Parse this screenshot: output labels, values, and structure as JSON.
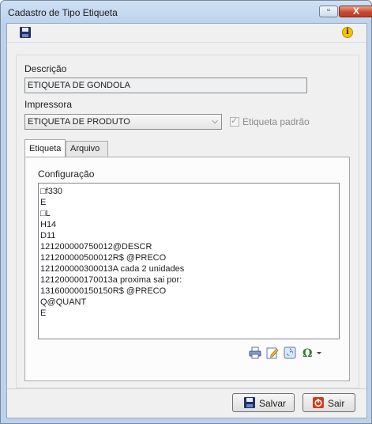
{
  "window": {
    "title": "Cadastro de Tipo Etiqueta",
    "min_symbol": "▫",
    "max_symbol": "◻",
    "close_symbol": "X"
  },
  "form": {
    "descricao_label": "Descrição",
    "descricao_value": "ETIQUETA DE GONDOLA",
    "impressora_label": "Impressora",
    "impressora_value": "ETIQUETA DE PRODUTO",
    "etiqueta_padrao_label": "Etiqueta padrão",
    "etiqueta_padrao_checked": true
  },
  "tabs": [
    {
      "label": "Etiqueta",
      "active": true
    },
    {
      "label": "Arquivo",
      "active": false
    }
  ],
  "config": {
    "label": "Configuração",
    "lines": [
      "□f330",
      "E",
      "□L",
      "H14",
      "D11",
      "121200000750012@DESCR",
      "121200000500012R$ @PRECO",
      "121200000300013A cada 2 unidades",
      "121200000170013a proxima sai por:",
      "131600000150150R$ @PRECO",
      "Q@QUANT",
      "E"
    ]
  },
  "buttons": {
    "salvar": "Salvar",
    "sair": "Sair"
  },
  "colors": {
    "accent_blue": "#20306e",
    "close_red": "#c84a30",
    "info_yellow": "#f5c400"
  }
}
